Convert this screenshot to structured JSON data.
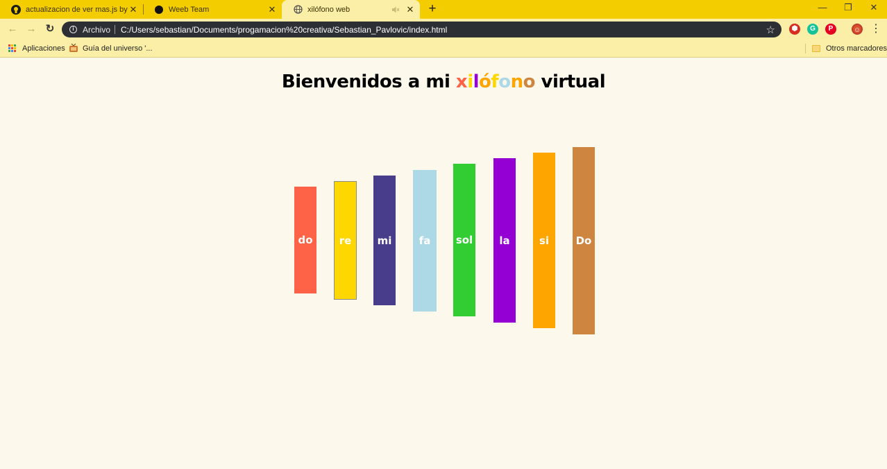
{
  "browser": {
    "tabs": [
      {
        "title": "actualizacion de ver mas.js by sebastian",
        "favicon": "github-icon",
        "close": "✕",
        "active": false
      },
      {
        "title": "Weeb Team",
        "favicon": "circle-dot-icon",
        "close": "✕",
        "active": false
      },
      {
        "title": "xilófono web",
        "favicon": "globe-icon",
        "close": "✕",
        "mute": "speaker-muted-icon",
        "active": true
      }
    ],
    "new_tab": "+",
    "window_controls": {
      "minimize": "—",
      "maximize": "❐",
      "close": "✕"
    },
    "toolbar": {
      "back": "←",
      "forward": "→",
      "reload": "↻",
      "info_label": "Archivo",
      "url": "C:/Users/sebastian/Documents/progamacion%20creativa/Sebastian_Pavlovic/index.html",
      "bookmark_star": "☆",
      "menu": "⋮",
      "extensions": [
        {
          "name": "ublock-icon",
          "color": "#d62d20"
        },
        {
          "name": "grammarly-icon",
          "color": "#15c39a"
        },
        {
          "name": "pinterest-icon",
          "color": "#e60023"
        },
        {
          "name": "profile-avatar-icon",
          "color": "#d94f2b"
        }
      ]
    },
    "bookmarks": {
      "apps_label": "Aplicaciones",
      "item1_label": "Guía del universo '...",
      "other_label": "Otros marcadores"
    }
  },
  "page": {
    "heading": {
      "prefix": "Bienvenidos a mi ",
      "letters": [
        {
          "char": "x",
          "color": "#ff6347"
        },
        {
          "char": "i",
          "color": "#ffd700"
        },
        {
          "char": "l",
          "color": "#9400d3"
        },
        {
          "char": "ó",
          "color": "#ffa500"
        },
        {
          "char": "f",
          "color": "#ffd700"
        },
        {
          "char": "o",
          "color": "#add8e6"
        },
        {
          "char": "n",
          "color": "#ffa500"
        },
        {
          "char": "o",
          "color": "#cd853f"
        }
      ],
      "suffix": " virtual"
    },
    "keys": [
      {
        "label": "do",
        "color": "#ff6347"
      },
      {
        "label": "re",
        "color": "#ffd700"
      },
      {
        "label": "mi",
        "color": "#483d8b"
      },
      {
        "label": "fa",
        "color": "#add8e6"
      },
      {
        "label": "sol",
        "color": "#32cd32"
      },
      {
        "label": "la",
        "color": "#9400d3"
      },
      {
        "label": "si",
        "color": "#ffa500"
      },
      {
        "label": "Do",
        "color": "#cd853f"
      }
    ]
  }
}
